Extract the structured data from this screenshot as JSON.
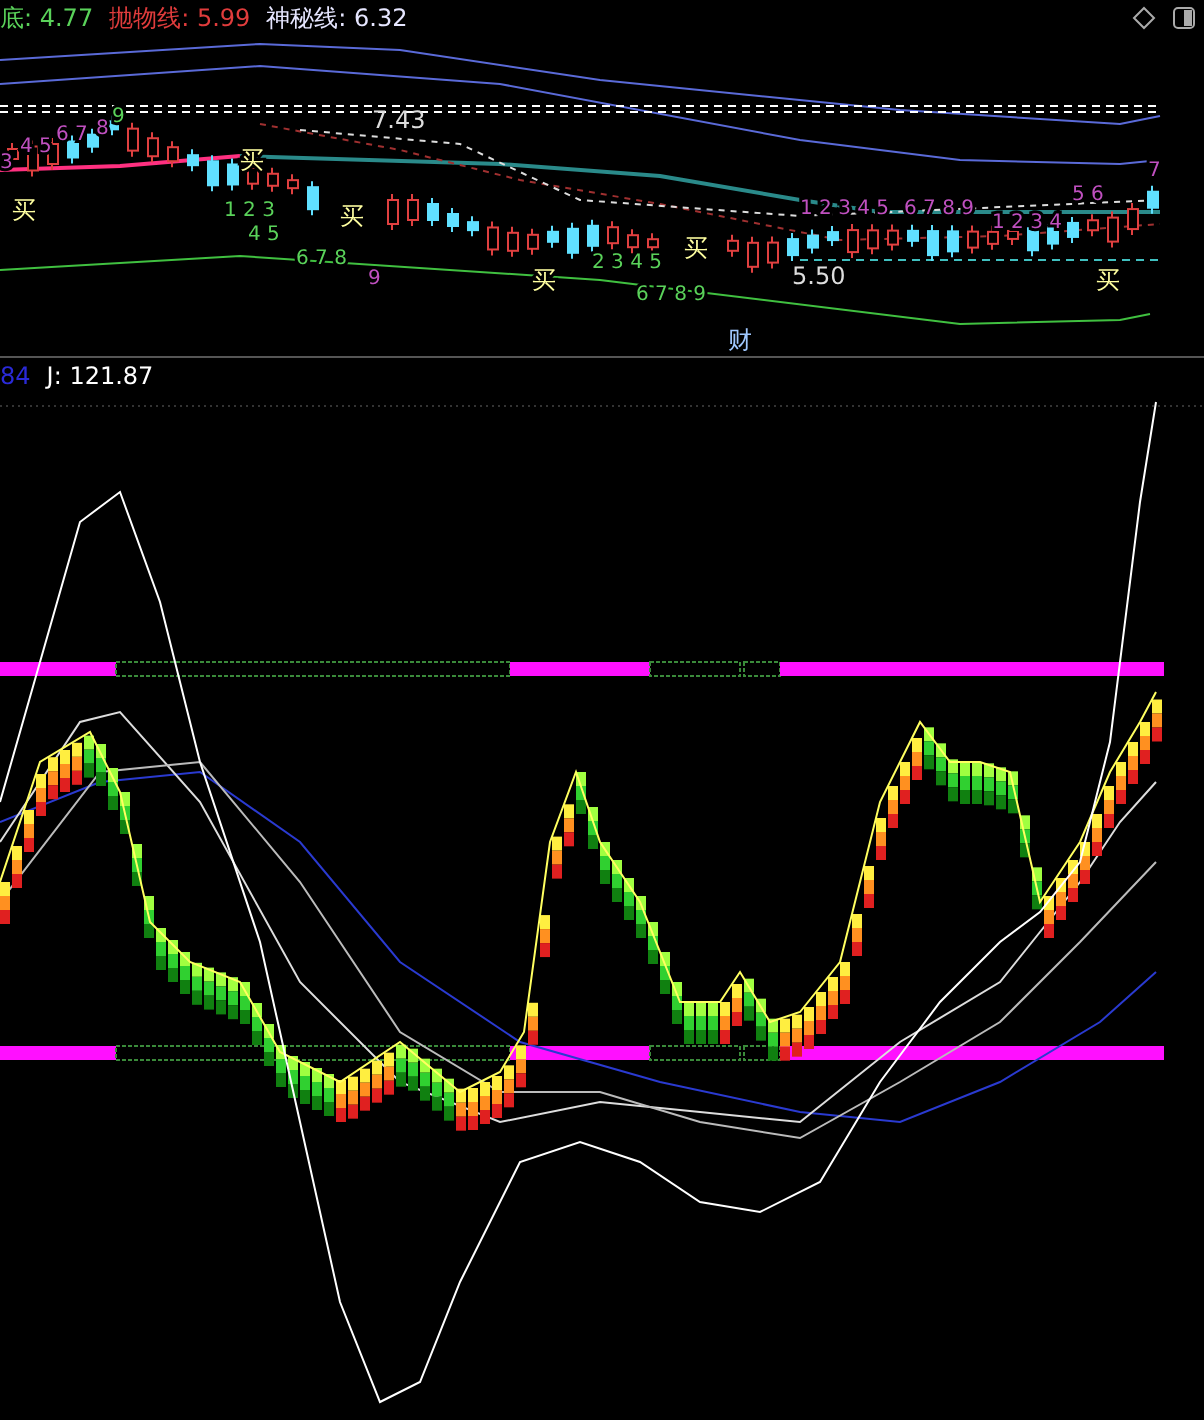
{
  "price_panel": {
    "legend": [
      {
        "label": "底: ",
        "value": "4.77",
        "color": "#5ad25a"
      },
      {
        "label": "抛物线: ",
        "value": "5.99",
        "color": "#e03c3c"
      },
      {
        "label": "神秘线: ",
        "value": "6.32",
        "color": "#e6e6ff"
      }
    ],
    "price_labels": [
      "7.43",
      "5.50"
    ],
    "signals": [
      "买",
      "买",
      "买",
      "买",
      "买",
      "买"
    ],
    "counts": [
      "3",
      "4 5",
      "6 7",
      "8",
      "9",
      "1 2 3",
      "4 5",
      "6 7 8",
      "9",
      "2 3 4 5",
      "6 7 8 9",
      "1 2 3 4 5",
      "6 7 8 9",
      "1 2 3 4",
      "5 6",
      "7"
    ],
    "marker": "财"
  },
  "indicator_panel": {
    "legend": [
      {
        "value": "84",
        "color": "#2a2ad8"
      },
      {
        "label": "J: ",
        "value": "121.87",
        "color": "#ffffff"
      }
    ]
  }
}
